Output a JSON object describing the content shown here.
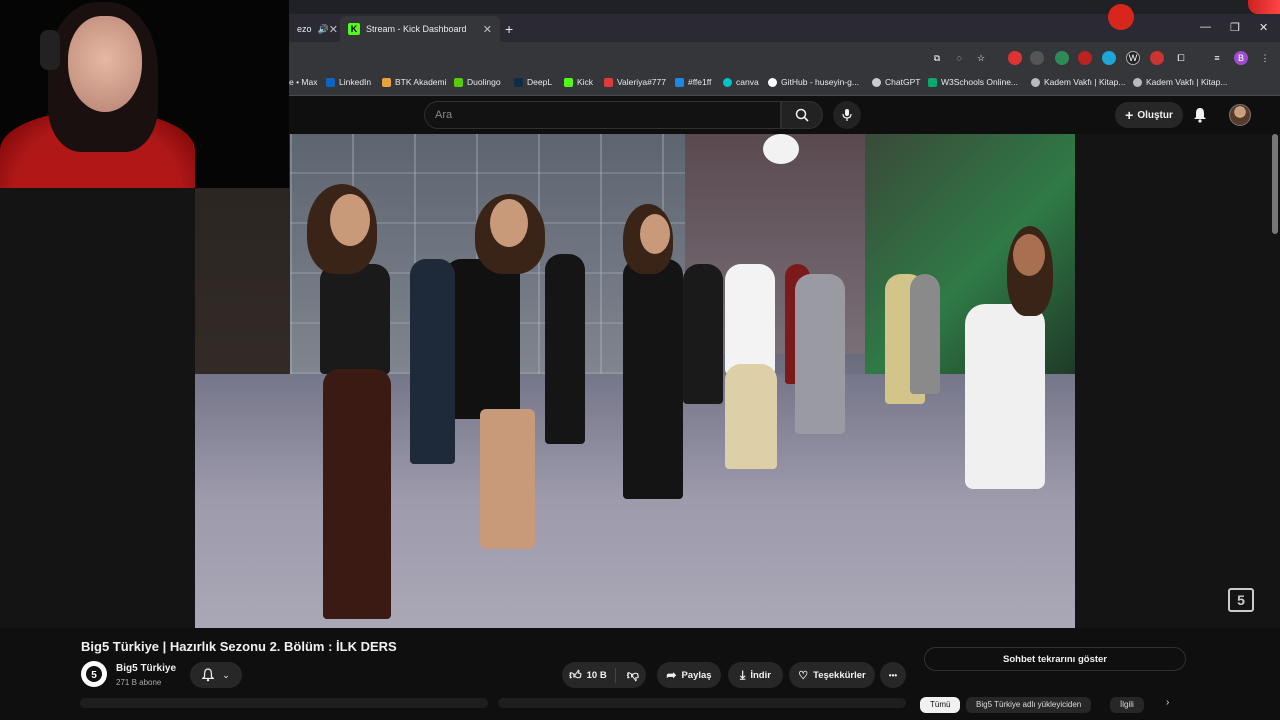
{
  "browser": {
    "tabs": [
      {
        "label": "ezo",
        "active": false
      },
      {
        "label": "Stream - Kick Dashboard",
        "active": true
      }
    ],
    "new_tab": "+",
    "bookmarks": [
      {
        "label": "e • Max",
        "color": "#888"
      },
      {
        "label": "LinkedIn",
        "color": "#0a66c2"
      },
      {
        "label": "BTK Akademi",
        "color": "#e8a33b"
      },
      {
        "label": "Duolingo",
        "color": "#58cc02"
      },
      {
        "label": "DeepL",
        "color": "#0f2b46"
      },
      {
        "label": "Kick",
        "color": "#53fc18"
      },
      {
        "label": "Valeriya#777",
        "color": "#e03a3a"
      },
      {
        "label": "#ffe1ff",
        "color": "#1e88e5"
      },
      {
        "label": "canva",
        "color": "#00c4cc"
      },
      {
        "label": "GitHub - huseyin-g...",
        "color": "#ffffff"
      },
      {
        "label": "ChatGPT",
        "color": "#cccccc"
      },
      {
        "label": "W3Schools Online...",
        "color": "#04aa6d"
      },
      {
        "label": "Kadem Vakfı | Kitap...",
        "color": "#bbbbbb"
      },
      {
        "label": "Kadem Vakfı | Kitap...",
        "color": "#bbbbbb"
      }
    ],
    "profile_initial": "B"
  },
  "youtube": {
    "search_placeholder": "Ara",
    "create_label": "Oluştur",
    "video_title": "Big5 Türkiye | Hazırlık Sezonu 2. Bölüm : İLK DERS",
    "channel_name": "Big5 Türkiye",
    "subscribers": "271 B abone",
    "likes": "10 B",
    "share_label": "Paylaş",
    "download_label": "İndir",
    "thanks_label": "Teşekkürler",
    "more_label": "•••",
    "chat_replay_label": "Sohbet tekrarını göster",
    "watermark": "5",
    "chips": [
      "Tümü",
      "Big5 Türkiye adlı yükleyiciden",
      "İlgili"
    ]
  }
}
